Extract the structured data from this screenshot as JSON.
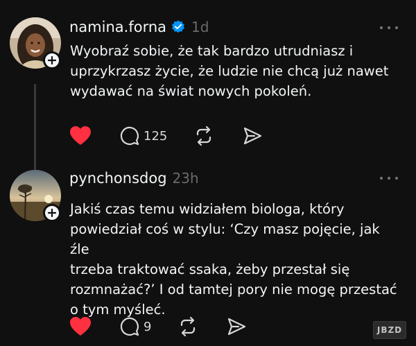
{
  "posts": [
    {
      "username": "namina.forna",
      "time": "1d",
      "verified": true,
      "text": "Wyobraź sobie, że tak bardzo utrudniasz i\nuprzykrzasz życie, że ludzie nie chcą już nawet\nwydawać na świat nowych pokoleń.",
      "reply_count": "125"
    },
    {
      "username": "pynchonsdog",
      "time": "23h",
      "verified": false,
      "text": "Jakiś czas temu widziałem biologa, który\npowiedział coś w stylu: ‘Czy masz pojęcie, jak źle\ntrzeba traktować ssaka, żeby przestał się\nrozmnażać?’ I od tamtej pory nie mogę przestać\no tym myśleć.",
      "reply_count": "9"
    }
  ],
  "colors": {
    "background": "#101010",
    "like": "#ff3040",
    "verified": "#0095f6",
    "muted": "#6b6b6b"
  },
  "icons": [
    "heart-icon",
    "comment-icon",
    "repost-icon",
    "share-icon",
    "verified-icon",
    "plus-icon",
    "more-icon"
  ],
  "watermark": "JBZD"
}
